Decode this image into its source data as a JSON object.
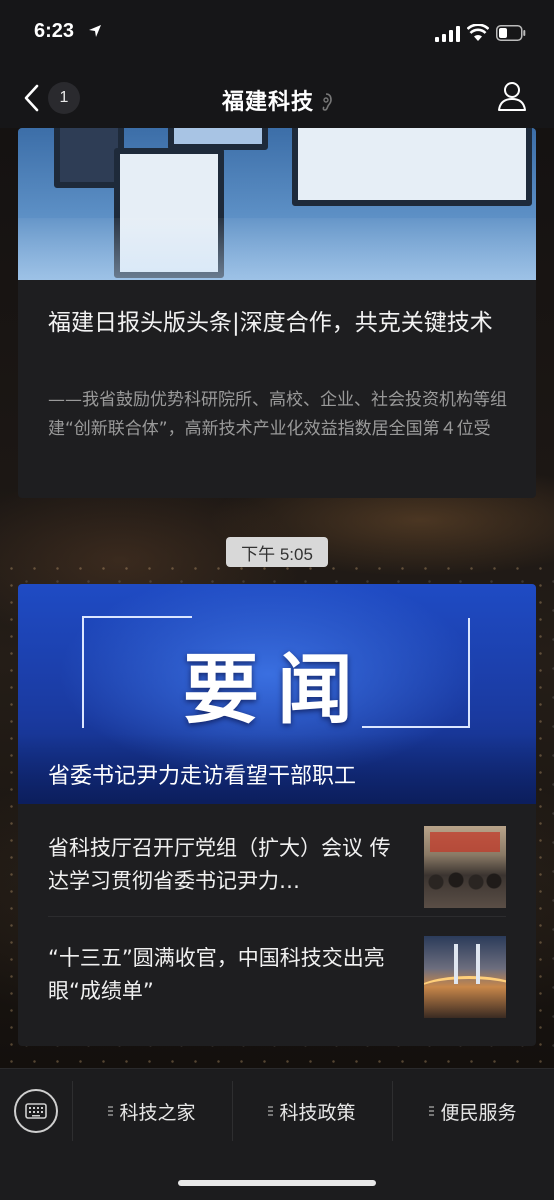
{
  "status_bar": {
    "time": "6:23"
  },
  "nav": {
    "unread_count": "1",
    "title": "福建科技"
  },
  "article_card": {
    "title": "福建日报头版头条|深度合作，共克关键技术",
    "digest": "——我省鼓励优势科研院所、高校、企业、社会投资机构等组建“创新联合体”，高新技术产业化效益指数居全国第４位受"
  },
  "timestamp": "下午 5:05",
  "news_card": {
    "hero_banner": "要闻",
    "hero_caption": "省委书记尹力走访看望干部职工",
    "items": [
      {
        "title": "省科技厅召开厅党组（扩大）会议 传达学习贯彻省委书记尹力…",
        "thumb": "meeting-photo"
      },
      {
        "title": "“十三五”圆满收官，中国科技交出亮眼“成绩单”",
        "thumb": "bridge-night-photo"
      }
    ]
  },
  "bottom_menu": {
    "items": [
      {
        "label": "科技之家"
      },
      {
        "label": "科技政策"
      },
      {
        "label": "便民服务"
      }
    ]
  },
  "colors": {
    "hero_blue": "#1f4bc4",
    "card_bg": "#1e1e20",
    "bar_bg": "#161618"
  }
}
